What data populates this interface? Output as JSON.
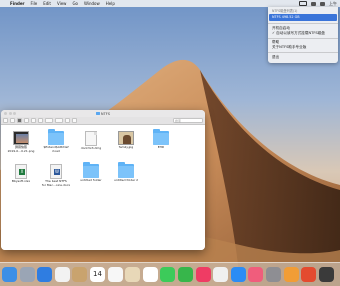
{
  "menubar": {
    "app_name": "Finder",
    "items": [
      "File",
      "Edit",
      "View",
      "Go",
      "Window",
      "Help"
    ],
    "clock": "上午"
  },
  "ntfs_menu": {
    "header": "NTFS磁盘列表(1)",
    "drive": "NTFS  498.52 GB",
    "items": [
      "开机自启动",
      "✓ 自动以读写方式挂载NTFS磁盘",
      "帮助",
      "关于NTFS助手专业版",
      "退出"
    ]
  },
  "finder": {
    "title": "NTFS",
    "search_placeholder": "搜索",
    "items": [
      {
        "name": "屏幕快照\n2019-0...0.21.png",
        "kind": "img"
      },
      {
        "name": "$Extend$AttrDef\nrload",
        "kind": "folder"
      },
      {
        "name": "dock3x3.dmg",
        "kind": "doc"
      },
      {
        "name": "family.jpg",
        "kind": "photo"
      },
      {
        "name": "EHD",
        "kind": "folder"
      },
      {
        "name": "Bbysoft.xlsx",
        "kind": "xlsx"
      },
      {
        "name": "The best NTFS\nfor Mac...oice.docx",
        "kind": "docx"
      },
      {
        "name": "untitled folder",
        "kind": "folder"
      },
      {
        "name": "untitled folder 2",
        "kind": "folder"
      }
    ]
  },
  "dock": {
    "apps": [
      {
        "name": "finder",
        "color": "#3d8fe6"
      },
      {
        "name": "launchpad",
        "color": "#9aa5b5"
      },
      {
        "name": "safari",
        "color": "#2f7de1"
      },
      {
        "name": "photos-app",
        "color": "#f2f2f2"
      },
      {
        "name": "notes",
        "color": "#c9a36e"
      },
      {
        "name": "calendar",
        "color": "#ffffff"
      },
      {
        "name": "reminders",
        "color": "#f7f7f7"
      },
      {
        "name": "contacts",
        "color": "#e8d8b8"
      },
      {
        "name": "photos",
        "color": "#ffffff"
      },
      {
        "name": "messages",
        "color": "#3ccb5a"
      },
      {
        "name": "facetime",
        "color": "#37b64b"
      },
      {
        "name": "itunes",
        "color": "#ef3c64"
      },
      {
        "name": "news",
        "color": "#f0f0f0"
      },
      {
        "name": "app-store",
        "color": "#2b8cf5"
      },
      {
        "name": "music",
        "color": "#f05d7c"
      },
      {
        "name": "preferences",
        "color": "#8e8e93"
      },
      {
        "name": "books",
        "color": "#f19d36"
      },
      {
        "name": "ntfs-helper",
        "color": "#e44b2f"
      },
      {
        "name": "trash-ntfs",
        "color": "#3a3a3a"
      }
    ],
    "calendar_day": "14"
  }
}
